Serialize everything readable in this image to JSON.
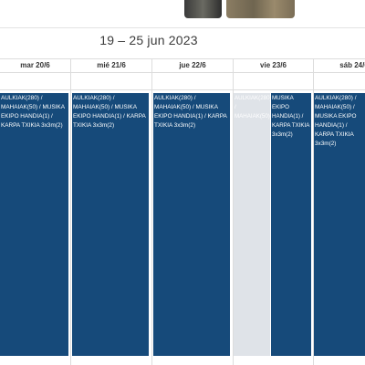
{
  "header": {
    "title": "19 – 25 jun 2023"
  },
  "days": [
    {
      "label": "mar 20/6"
    },
    {
      "label": "mié 21/6"
    },
    {
      "label": "jue 22/6"
    },
    {
      "label": "vie 23/6"
    },
    {
      "label": "sáb 24/6"
    }
  ],
  "events": [
    {
      "text": "AULKIAK(280) / MAHAIAK(50) / MUSIKA EKIPO HANDIA(1) / KARPA TXIKIA 3x3m(2)"
    },
    {
      "text": "AULKIAK(280) / MAHAIAK(50) / MUSIKA EKIPO HANDIA(1) / KARPA TXIKIA 3x3m(2)"
    },
    {
      "text": "AULKIAK(280) / MAHAIAK(50) / MUSIKA EKIPO HANDIA(1) / KARPA TXIKIA 3x3m(2)"
    },
    {
      "text": "AULKIAK(280) / MAHAIAK(50)"
    },
    {
      "text": "MUSIKA EKIPO HANDIA(1) / KARPA TXIKIA 3x3m(2)"
    },
    {
      "text": "AULKIAK(280) / MAHAIAK(50) / MUSIKA EKIPO HANDIA(1) / KARPA TXIKIA 3x3m(2)"
    }
  ],
  "colors": {
    "event": "#164a7a",
    "event_faded": "#dfe3e8"
  }
}
